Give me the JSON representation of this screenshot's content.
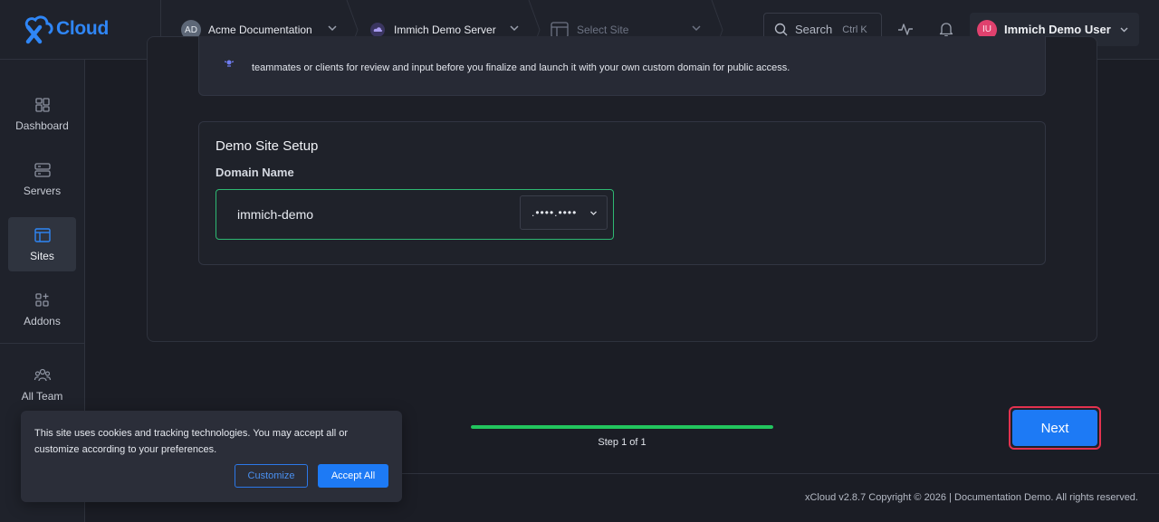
{
  "header": {
    "logo_text": "Cloud",
    "team": {
      "initials": "AD",
      "name": "Acme Documentation"
    },
    "server": {
      "name": "Immich Demo Server"
    },
    "site": {
      "placeholder": "Select Site"
    },
    "search": {
      "label": "Search",
      "shortcut": "Ctrl K"
    },
    "user": {
      "initials": "IU",
      "name": "Immich Demo User"
    }
  },
  "sidebar": {
    "items": [
      {
        "label": "Dashboard",
        "icon": "dashboard-icon"
      },
      {
        "label": "Servers",
        "icon": "servers-icon"
      },
      {
        "label": "Sites",
        "icon": "sites-icon",
        "active": true
      },
      {
        "label": "Addons",
        "icon": "addons-icon"
      },
      {
        "label": "All Team",
        "icon": "team-icon"
      }
    ]
  },
  "info": {
    "text": "teammates or clients for review and input before you finalize and launch it with your own custom domain for public access."
  },
  "setup": {
    "title": "Demo Site Setup",
    "domain_label": "Domain Name",
    "domain_value": "immich-demo",
    "domain_suffix": ".••••.••••"
  },
  "progress": {
    "fraction": 1.0,
    "step_text": "Step 1 of 1"
  },
  "actions": {
    "next_label": "Next"
  },
  "footer": {
    "text": "xCloud v2.8.7 Copyright © 2026 | Documentation Demo. All rights reserved."
  },
  "cookie": {
    "text": "This site uses cookies and tracking technologies. You may accept all or customize according to your preferences.",
    "customize_label": "Customize",
    "accept_label": "Accept All"
  },
  "colors": {
    "accent": "#1d7af5",
    "success": "#22c55e",
    "highlight": "#e2324f"
  }
}
